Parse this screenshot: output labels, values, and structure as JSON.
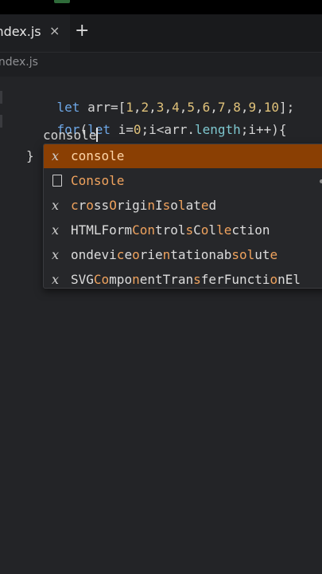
{
  "tab": {
    "label": "index.js",
    "close_glyph": "×",
    "new_glyph": "+"
  },
  "breadcrumb": "index.js",
  "code": {
    "line1": [
      "let",
      " arr=[",
      "1",
      ",",
      "2",
      ",",
      "3",
      ",",
      "4",
      ",",
      "5",
      ",",
      "6",
      ",",
      "7",
      ",",
      "8",
      ",",
      "9",
      ",",
      "10",
      "];"
    ],
    "line2": [
      "for",
      "(",
      "let",
      " i=",
      "0",
      ";i<arr.",
      "length",
      ";i++){"
    ],
    "line3": "console",
    "line4": "}"
  },
  "suggestions": [
    {
      "icon": "variable-icon",
      "label": "console",
      "selected": true
    },
    {
      "icon": "file-icon",
      "label": "Console",
      "selected": false
    },
    {
      "icon": "variable-icon",
      "label": "crossOriginIsolated",
      "selected": false
    },
    {
      "icon": "variable-icon",
      "label": "HTMLFormControlsCollection",
      "selected": false
    },
    {
      "icon": "variable-icon",
      "label": "ondeviceorientationabsolute",
      "selected": false
    },
    {
      "icon": "variable-icon",
      "label": "SVGComponentTransferFunctionEl",
      "selected": false
    }
  ],
  "colors": {
    "selection": "#8a3f03",
    "keyword": "#6ea8e8",
    "number": "#e0c27a",
    "match": "#f0a35e"
  }
}
